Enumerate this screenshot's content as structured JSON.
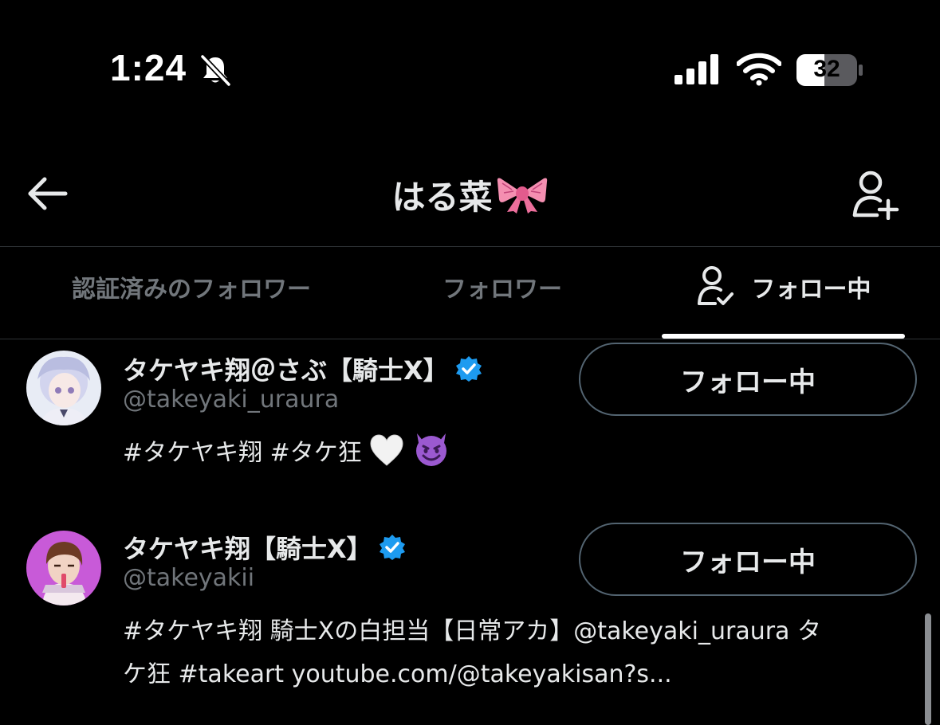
{
  "status_bar": {
    "time": "1:24",
    "battery": "32",
    "icons": [
      "bell-slash-icon",
      "cellular-signal-icon",
      "wifi-icon",
      "battery-icon"
    ]
  },
  "header": {
    "title": "はる菜",
    "title_emoji": "ribbon",
    "back_icon": "arrow-left-icon",
    "add_user_icon": "person-plus-icon"
  },
  "tabs": [
    {
      "label": "認証済みのフォロワー",
      "active": false
    },
    {
      "label": "フォロワー",
      "active": false
    },
    {
      "label": "フォロー中",
      "active": true,
      "icon": "person-check-icon"
    }
  ],
  "users": [
    {
      "display_name": "タケヤキ翔＠さぶ【騎士X】",
      "handle": "@takeyaki_uraura",
      "verified": true,
      "bio": "#タケヤキ翔 #タケ狂",
      "bio_emojis": [
        "white-heart",
        "smiling-imp"
      ],
      "button_label": "フォロー中",
      "avatar_colors": [
        "#e8ecf5",
        "#b9bde0"
      ]
    },
    {
      "display_name": "タケヤキ翔【騎士X】",
      "handle": "@takeyakii",
      "verified": true,
      "bio_line1": "#タケヤキ翔 騎士Xの白担当【日常アカ】@takeyaki_uraura タ",
      "bio_line2": "ケ狂 #takeart youtube.com/@takeyakisan?s...",
      "button_label": "フォロー中",
      "avatar_colors": [
        "#c85ad8",
        "#f4e9ef"
      ]
    }
  ],
  "colors": {
    "background": "#000000",
    "text_primary": "#e7e9ea",
    "text_secondary": "#71767b",
    "verified": "#1d9bf0",
    "divider": "#2f3336"
  }
}
